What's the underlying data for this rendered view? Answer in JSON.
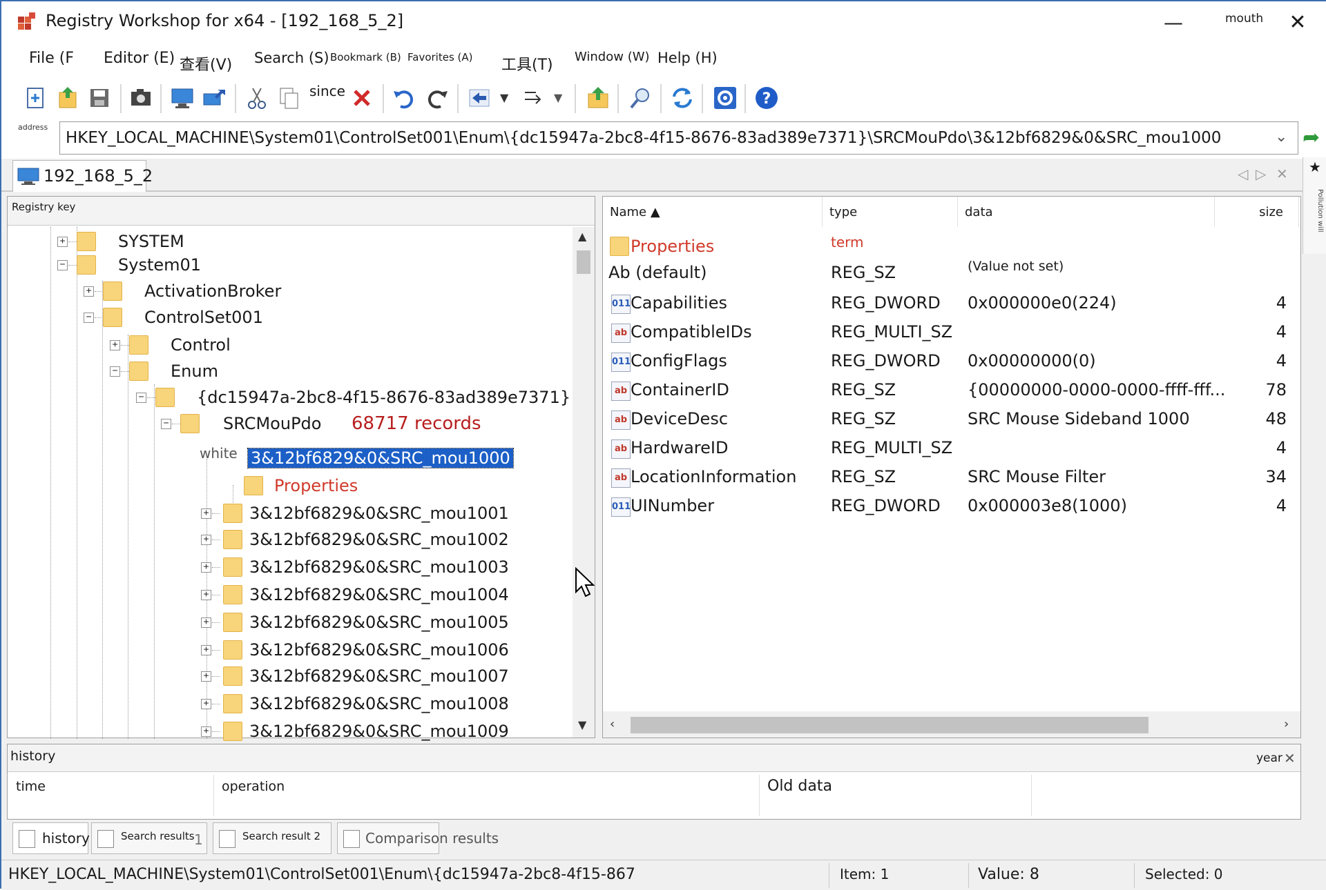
{
  "window": {
    "title": "Registry Workshop for x64 - [192_168_5_2]",
    "minimize": "—",
    "extra_label": "mouth",
    "close": "✕"
  },
  "menu": [
    "File (F",
    "Editor (E)",
    "查看(V)",
    "Search (S)",
    "Bookmark (B)",
    "Favorites (A)",
    "工具(T)",
    "Window (W)",
    "Help (H)"
  ],
  "toolbar": {
    "since_label": "since",
    "icons": [
      "new-key-icon",
      "export-icon",
      "save-icon",
      "snapshot-icon",
      "connect-icon",
      "remote-icon",
      "cut-icon",
      "copy-icon",
      "delete-icon",
      "undo-icon",
      "redo-icon",
      "back-icon",
      "forward-icon",
      "up-level-icon",
      "find-icon",
      "refresh-icon",
      "settings-icon",
      "help-icon"
    ]
  },
  "address": {
    "label": "address",
    "value": "HKEY_LOCAL_MACHINE\\System01\\ControlSet001\\Enum\\{dc15947a-2bc8-4f15-8676-83ad389e7371}\\SRCMouPdo\\3&12bf6829&0&SRC_mou1000"
  },
  "connection_tab": {
    "label": "192_168_5_2"
  },
  "tree": {
    "header": "Registry key",
    "records_note": "68717 records",
    "white_label": "white",
    "items": [
      {
        "label": "SYSTEM",
        "expander": "+"
      },
      {
        "label": "System01",
        "expander": "−"
      },
      {
        "label": "ActivationBroker",
        "expander": "+"
      },
      {
        "label": "ControlSet001",
        "expander": "−"
      },
      {
        "label": "Control",
        "expander": "+"
      },
      {
        "label": "Enum",
        "expander": "−"
      },
      {
        "label": "{dc15947a-2bc8-4f15-8676-83ad389e7371}",
        "expander": "−"
      },
      {
        "label": "SRCMouPdo",
        "expander": "−"
      },
      {
        "label": "3&12bf6829&0&SRC_mou1000",
        "expander": ""
      },
      {
        "label": "Properties",
        "expander": ""
      },
      {
        "label": "3&12bf6829&0&SRC_mou1001",
        "expander": "+"
      },
      {
        "label": "3&12bf6829&0&SRC_mou1002",
        "expander": "+"
      },
      {
        "label": "3&12bf6829&0&SRC_mou1003",
        "expander": "+"
      },
      {
        "label": "3&12bf6829&0&SRC_mou1004",
        "expander": "+"
      },
      {
        "label": "3&12bf6829&0&SRC_mou1005",
        "expander": "+"
      },
      {
        "label": "3&12bf6829&0&SRC_mou1006",
        "expander": "+"
      },
      {
        "label": "3&12bf6829&0&SRC_mou1007",
        "expander": "+"
      },
      {
        "label": "3&12bf6829&0&SRC_mou1008",
        "expander": "+"
      },
      {
        "label": "3&12bf6829&0&SRC_mou1009",
        "expander": "+"
      }
    ]
  },
  "values": {
    "columns": [
      "Name ▲",
      "type",
      "data",
      "size"
    ],
    "rows": [
      {
        "name": "Properties",
        "type": "term",
        "data": "",
        "size": "",
        "icon": "folder"
      },
      {
        "name": "Ab (default)",
        "type": "REG_SZ",
        "data": "(Value not set)",
        "size": "",
        "icon": ""
      },
      {
        "name": "Capabilities",
        "type": "REG_DWORD",
        "data": "0x000000e0(224)",
        "size": "4",
        "icon": "dword"
      },
      {
        "name": "CompatibleIDs",
        "type": "REG_MULTI_SZ",
        "data": "",
        "size": "4",
        "icon": "ab"
      },
      {
        "name": "ConfigFlags",
        "type": "REG_DWORD",
        "data": "0x00000000(0)",
        "size": "4",
        "icon": "dword"
      },
      {
        "name": "ContainerID",
        "type": "REG_SZ",
        "data": "{00000000-0000-0000-ffff-fff...",
        "size": "78",
        "icon": "ab"
      },
      {
        "name": "DeviceDesc",
        "type": "REG_SZ",
        "data": "SRC Mouse Sideband 1000",
        "size": "48",
        "icon": "ab"
      },
      {
        "name": "HardwareID",
        "type": "REG_MULTI_SZ",
        "data": "",
        "size": "4",
        "icon": "ab"
      },
      {
        "name": "LocationInformation",
        "type": "REG_SZ",
        "data": "SRC Mouse Filter",
        "size": "34",
        "icon": "ab"
      },
      {
        "name": "UINumber",
        "type": "REG_DWORD",
        "data": "0x000003e8(1000)",
        "size": "4",
        "icon": "dword"
      }
    ]
  },
  "history": {
    "title": "history",
    "corner_label": "year",
    "columns": [
      "time",
      "operation",
      "Old data"
    ]
  },
  "bottom_tabs": [
    "history",
    "Search results",
    "1",
    "Search result 2",
    "Comparison results"
  ],
  "status": {
    "path": "HKEY_LOCAL_MACHINE\\System01\\ControlSet001\\Enum\\{dc15947a-2bc8-4f15-867",
    "item": "Item: 1",
    "value": "Value: 8",
    "selected": "Selected: 0"
  },
  "side_strip": {
    "label": "Pollution will"
  },
  "colors": {
    "accent": "#1c5fc7",
    "red_text": "#d03a2a",
    "records_text": "#b81e1e",
    "folder": "#f8d47a"
  }
}
